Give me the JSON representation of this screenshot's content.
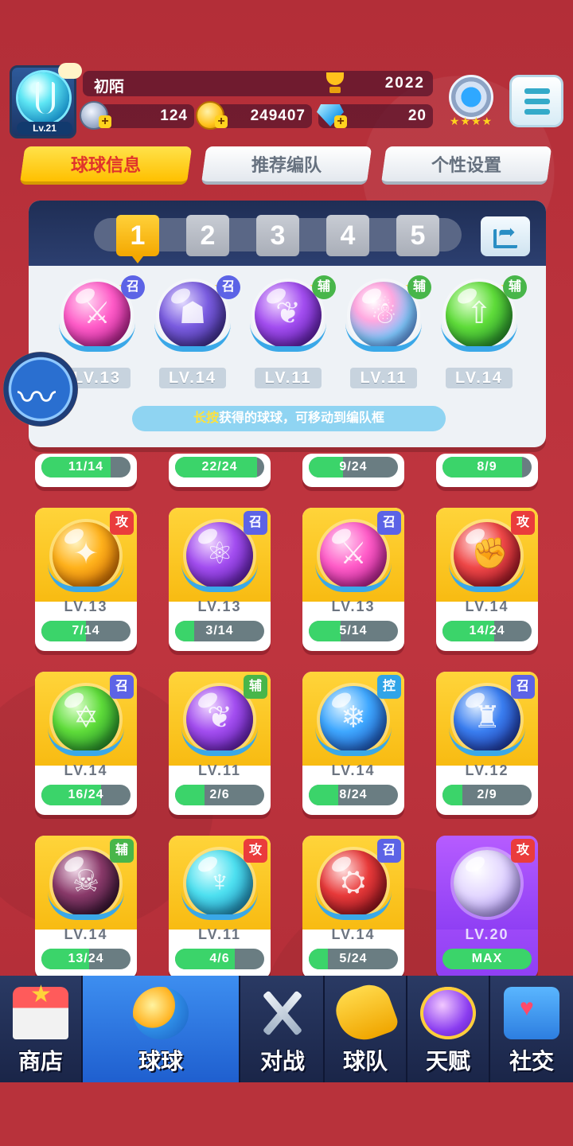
{
  "player": {
    "name": "初陌",
    "level": "Lv.21",
    "trophies": "2022",
    "silver": "124",
    "gold": "249407",
    "diamonds": "20",
    "rank_stars": "★★★★"
  },
  "tabs": [
    {
      "label": "球球信息",
      "active": true
    },
    {
      "label": "推荐编队",
      "active": false
    },
    {
      "label": "个性设置",
      "active": false
    }
  ],
  "team_slots": [
    "1",
    "2",
    "3",
    "4",
    "5"
  ],
  "active_slot": "1",
  "team_balls": [
    {
      "level": "LV.13",
      "type": "召",
      "color": "pink",
      "glyph": "⚔"
    },
    {
      "level": "LV.14",
      "type": "召",
      "color": "violet",
      "glyph": "☗"
    },
    {
      "level": "LV.11",
      "type": "辅",
      "color": "purple",
      "glyph": "❦"
    },
    {
      "level": "LV.11",
      "type": "辅",
      "color": "rainbow",
      "glyph": "☃"
    },
    {
      "level": "LV.14",
      "type": "辅",
      "color": "green",
      "glyph": "⇧"
    }
  ],
  "hint": {
    "highlight": "长按",
    "text": "获得的球球，可移动到编队框"
  },
  "partial_cards": [
    {
      "progress": "11/14",
      "fill": 0.78
    },
    {
      "progress": "22/24",
      "fill": 0.92
    },
    {
      "progress": "9/24",
      "fill": 0.38
    },
    {
      "progress": "8/9",
      "fill": 0.89
    }
  ],
  "cards": [
    {
      "level": "LV.13",
      "progress": "7/14",
      "fill": 0.5,
      "type": "攻",
      "color": "amber",
      "glyph": "✦",
      "card": "yellow"
    },
    {
      "level": "LV.13",
      "progress": "3/14",
      "fill": 0.21,
      "type": "召",
      "color": "purple",
      "glyph": "⚛",
      "card": "yellow"
    },
    {
      "level": "LV.13",
      "progress": "5/14",
      "fill": 0.36,
      "type": "召",
      "color": "pink",
      "glyph": "⚔",
      "card": "yellow"
    },
    {
      "level": "LV.14",
      "progress": "14/24",
      "fill": 0.58,
      "type": "攻",
      "color": "red",
      "glyph": "✊",
      "card": "yellow"
    },
    {
      "level": "LV.14",
      "progress": "16/24",
      "fill": 0.67,
      "type": "召",
      "color": "green",
      "glyph": "✡",
      "card": "yellow"
    },
    {
      "level": "LV.11",
      "progress": "2/6",
      "fill": 0.33,
      "type": "辅",
      "color": "purple",
      "glyph": "❦",
      "card": "yellow"
    },
    {
      "level": "LV.14",
      "progress": "8/24",
      "fill": 0.33,
      "type": "控",
      "color": "blue",
      "glyph": "❄",
      "card": "yellow"
    },
    {
      "level": "LV.12",
      "progress": "2/9",
      "fill": 0.22,
      "type": "召",
      "color": "deepblue",
      "glyph": "♜",
      "card": "yellow"
    },
    {
      "level": "LV.14",
      "progress": "13/24",
      "fill": 0.54,
      "type": "辅",
      "color": "dark",
      "glyph": "☠",
      "card": "yellow"
    },
    {
      "level": "LV.11",
      "progress": "4/6",
      "fill": 0.67,
      "type": "攻",
      "color": "cyan",
      "glyph": "♆",
      "card": "yellow"
    },
    {
      "level": "LV.14",
      "progress": "5/24",
      "fill": 0.21,
      "type": "召",
      "color": "crimson",
      "glyph": "⛭",
      "card": "yellow"
    },
    {
      "level": "LV.20",
      "progress": "MAX",
      "fill": 1.0,
      "type": "攻",
      "color": "lilac",
      "glyph": "",
      "card": "purple"
    }
  ],
  "nav": [
    {
      "label": "商店",
      "icon": "shop-icon",
      "active": false
    },
    {
      "label": "球球",
      "icon": "ball-icon",
      "active": true
    },
    {
      "label": "对战",
      "icon": "battle-swords-icon",
      "active": false
    },
    {
      "label": "球队",
      "icon": "whistle-icon",
      "active": false
    },
    {
      "label": "天赋",
      "icon": "talent-planet-icon",
      "active": false
    },
    {
      "label": "社交",
      "icon": "social-chat-icon",
      "active": false
    }
  ],
  "colors": {
    "background": "#b7303a",
    "tab_active": "#ffc000",
    "tag_summon": "#5c63e6",
    "tag_support": "#48b64a",
    "tag_attack": "#ea3c3c",
    "tag_control": "#2fa4e8",
    "progress_fill": "#3bd46a",
    "nav_active": "#3d8ef0"
  }
}
